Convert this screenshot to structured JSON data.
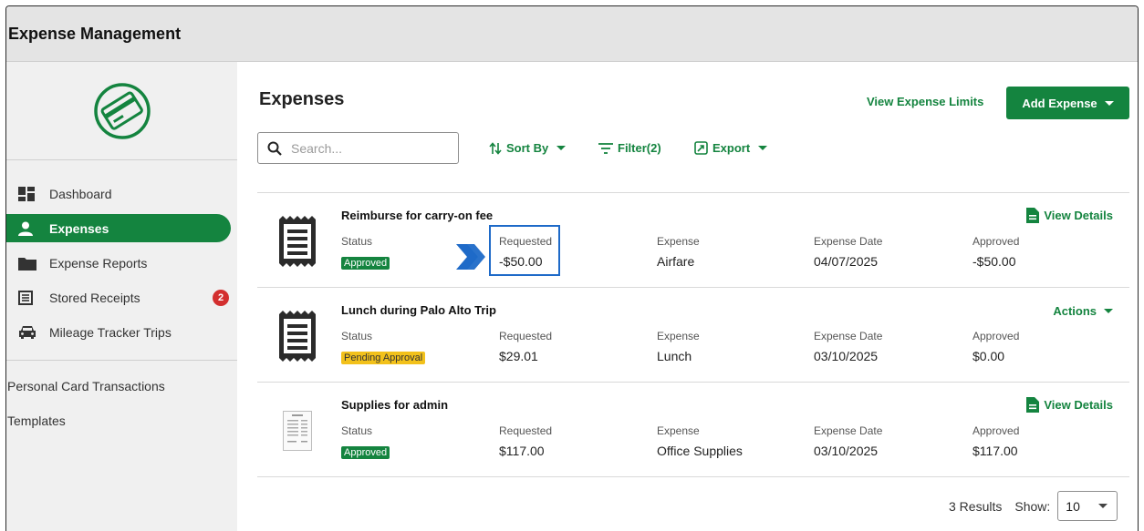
{
  "app": {
    "title": "Expense Management"
  },
  "colors": {
    "brand": "#14843f",
    "approved": "#14843f",
    "pending": "#f2c11b",
    "badge": "#d32f2f",
    "highlight": "#1e6ac8"
  },
  "sidebar": {
    "logo": "credit-card-logo",
    "items": [
      {
        "label": "Dashboard",
        "icon": "dashboard-icon"
      },
      {
        "label": "Expenses",
        "icon": "person-icon",
        "active": true
      },
      {
        "label": "Expense Reports",
        "icon": "folder-icon"
      },
      {
        "label": "Stored Receipts",
        "icon": "receipt-list-icon",
        "badge": "2"
      },
      {
        "label": "Mileage Tracker Trips",
        "icon": "car-icon"
      }
    ],
    "secondary": [
      {
        "label": "Personal Card Transactions"
      },
      {
        "label": "Templates"
      }
    ]
  },
  "header": {
    "title": "Expenses",
    "view_limits": "View Expense Limits",
    "add_expense": "Add Expense"
  },
  "toolbar": {
    "search_placeholder": "Search...",
    "sort_label": "Sort By",
    "filter_label": "Filter(2)",
    "export_label": "Export"
  },
  "columns": {
    "status": "Status",
    "requested": "Requested",
    "expense": "Expense",
    "date": "Expense Date",
    "approved": "Approved"
  },
  "expenses": [
    {
      "title": "Reimburse for carry-on fee",
      "status": "Approved",
      "requested": "-$50.00",
      "expense": "Airfare",
      "date": "04/07/2025",
      "approved": "-$50.00",
      "action": "View Details"
    },
    {
      "title": "Lunch during Palo Alto Trip",
      "status": "Pending Approval",
      "requested": "$29.01",
      "expense": "Lunch",
      "date": "03/10/2025",
      "approved": "$0.00",
      "action": "Actions"
    },
    {
      "title": "Supplies for admin",
      "status": "Approved",
      "requested": "$117.00",
      "expense": "Office Supplies",
      "date": "03/10/2025",
      "approved": "$117.00",
      "action": "View Details"
    }
  ],
  "footer": {
    "results": "3 Results",
    "show_label": "Show:",
    "page_size": "10"
  }
}
